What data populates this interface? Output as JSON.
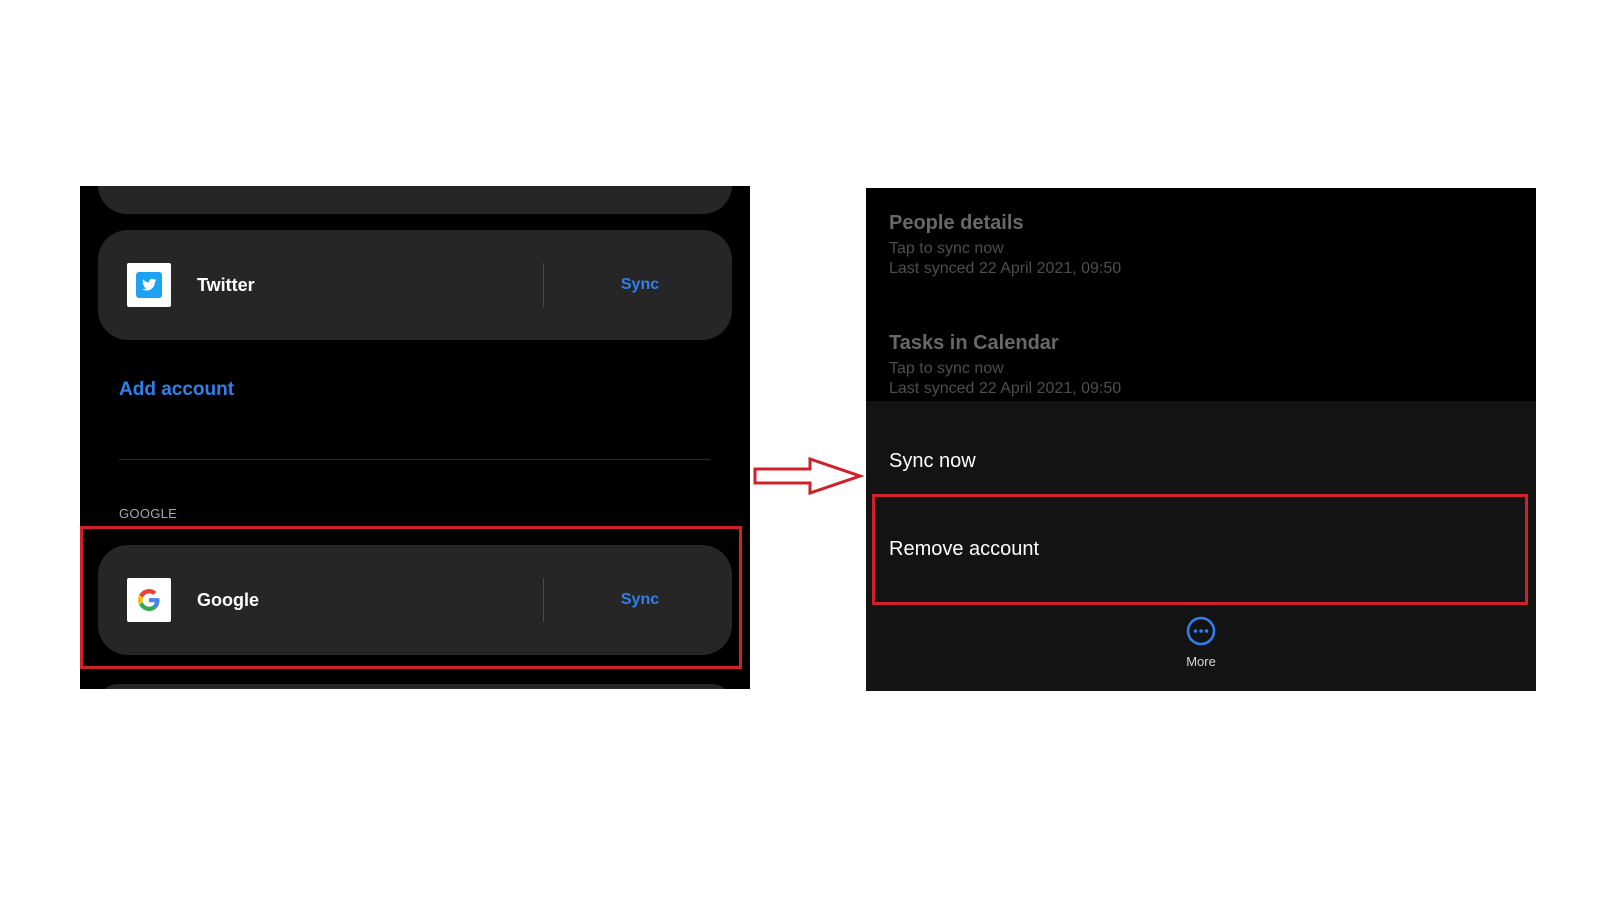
{
  "left_screen": {
    "accounts": [
      {
        "name": "Twitter",
        "icon": "twitter-icon",
        "sync_label": "Sync"
      },
      {
        "name": "Google",
        "icon": "google-icon",
        "sync_label": "Sync"
      }
    ],
    "add_account_label": "Add account",
    "section_label": "GOOGLE"
  },
  "right_screen": {
    "sync_items": [
      {
        "title": "People details",
        "subtitle": "Tap to sync now",
        "last_synced": "Last synced 22 April 2021, 09:50"
      },
      {
        "title": "Tasks in Calendar",
        "subtitle": "Tap to sync now",
        "last_synced": "Last synced 22 April 2021, 09:50"
      }
    ],
    "menu": {
      "sync_now": "Sync now",
      "remove_account": "Remove account"
    },
    "more_label": "More"
  },
  "colors": {
    "accent_blue": "#2f80ed",
    "highlight_red": "#d0202a",
    "card_bg": "#262626",
    "twitter_blue": "#1da1f2"
  }
}
